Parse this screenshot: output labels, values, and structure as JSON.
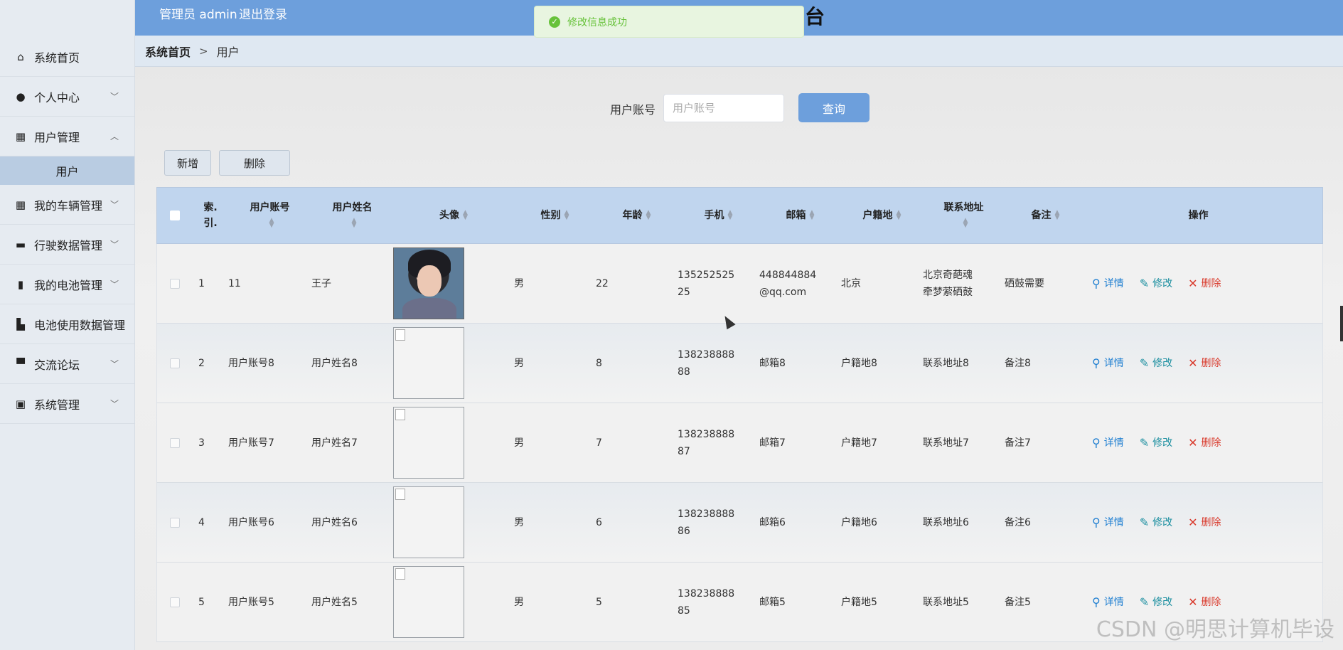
{
  "header": {
    "admin_label": "管理员 admin",
    "logout_label": "退出登录",
    "title_fragment": "台"
  },
  "toast": {
    "message": "修改信息成功",
    "color": "#67c23a"
  },
  "breadcrumb": {
    "home": "系统首页",
    "separator": ">",
    "current": "用户"
  },
  "sidebar": {
    "items": [
      {
        "label": "系统首页",
        "icon": "home-icon"
      },
      {
        "label": "个人中心",
        "icon": "user-icon",
        "chevron": "down"
      },
      {
        "label": "用户管理",
        "icon": "grid-icon",
        "chevron": "up",
        "expanded": true
      },
      {
        "label": "我的车辆管理",
        "icon": "grid-icon",
        "chevron": "down"
      },
      {
        "label": "行驶数据管理",
        "icon": "monitor-icon",
        "chevron": "down"
      },
      {
        "label": "我的电池管理",
        "icon": "clipboard-icon",
        "chevron": "down"
      },
      {
        "label": "电池使用数据管理",
        "icon": "bar-chart-icon"
      },
      {
        "label": "交流论坛",
        "icon": "chat-icon",
        "chevron": "down"
      },
      {
        "label": "系统管理",
        "icon": "settings-clipboard-icon",
        "chevron": "down"
      }
    ],
    "submenu": {
      "label": "用户"
    }
  },
  "search": {
    "label": "用户账号",
    "placeholder": "用户账号",
    "button": "查询"
  },
  "actions": {
    "add": "新增",
    "delete": "删除"
  },
  "table": {
    "headers": {
      "index": "索.\n引.",
      "account": "用户账号",
      "name": "用户姓名",
      "avatar": "头像",
      "sex": "性别",
      "age": "年龄",
      "phone": "手机",
      "email": "邮箱",
      "home": "户籍地",
      "address": "联系地址",
      "note": "备注",
      "ops": "操作"
    },
    "rows": [
      {
        "index": "1",
        "account": "11",
        "name": "王子",
        "avatar": "photo",
        "sex": "男",
        "age": "22",
        "phone": "135252525\n25",
        "email": "448844884\n@qq.com",
        "home": "北京",
        "address": "北京奇葩魂\n牵梦萦硒鼓",
        "note": "硒鼓需要"
      },
      {
        "index": "2",
        "account": "用户账号8",
        "name": "用户姓名8",
        "avatar": "broken",
        "sex": "男",
        "age": "8",
        "phone": "138238888\n88",
        "email": "邮箱8",
        "home": "户籍地8",
        "address": "联系地址8",
        "note": "备注8"
      },
      {
        "index": "3",
        "account": "用户账号7",
        "name": "用户姓名7",
        "avatar": "broken",
        "sex": "男",
        "age": "7",
        "phone": "138238888\n87",
        "email": "邮箱7",
        "home": "户籍地7",
        "address": "联系地址7",
        "note": "备注7"
      },
      {
        "index": "4",
        "account": "用户账号6",
        "name": "用户姓名6",
        "avatar": "broken",
        "sex": "男",
        "age": "6",
        "phone": "138238888\n86",
        "email": "邮箱6",
        "home": "户籍地6",
        "address": "联系地址6",
        "note": "备注6"
      },
      {
        "index": "5",
        "account": "用户账号5",
        "name": "用户姓名5",
        "avatar": "broken",
        "sex": "男",
        "age": "5",
        "phone": "138238888\n85",
        "email": "邮箱5",
        "home": "户籍地5",
        "address": "联系地址5",
        "note": "备注5"
      }
    ],
    "op_labels": {
      "detail": "详情",
      "edit": "修改",
      "delete": "删除"
    }
  },
  "watermark": "CSDN @明思计算机毕设",
  "colors": {
    "header": "#6d9fdc",
    "table_header": "#c0d5ee",
    "detail": "#1f7fd1",
    "edit": "#1c8fa0",
    "delete": "#d93a2c"
  }
}
